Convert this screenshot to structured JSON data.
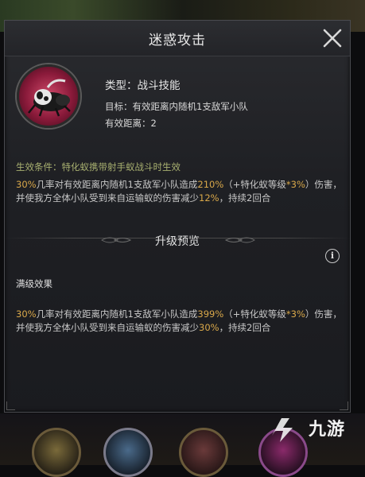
{
  "dialog": {
    "title": "迷惑攻击",
    "skill": {
      "type": "类型：战斗技能",
      "target": "目标：有效距离内随机1支敌军小队",
      "range": "有效距离：2",
      "icon": "ant-skill-icon"
    },
    "condition": "生效条件：特化蚁携带射手蚁战斗时生效",
    "effect": {
      "p1": "30%",
      "t1": "几率对有效距离内随机1支敌军小队造成",
      "p2": "210%",
      "t2": "（+特化蚁等级",
      "p3": "*3%",
      "t3": "）伤害，并使我方全体小队受到来自运输蚁的伤害减少",
      "p4": "12%",
      "t4": "，持续2回合"
    },
    "upgrade_title": "升级预览",
    "max_label": "满级效果",
    "max_effect": {
      "p1": "30%",
      "t1": "几率对有效距离内随机1支敌军小队造成",
      "p2": "399%",
      "t2": "（+特化蚁等级",
      "p3": "*3%",
      "t3": "）伤害，并使我方全体小队受到来自运输蚁的伤害减少",
      "p4": "30%",
      "t4": "，持续2回合"
    },
    "info_glyph": "i"
  },
  "watermark": {
    "text": "九游"
  },
  "colors": {
    "highlight": "#d9a84a",
    "condition": "#a8b070",
    "icon_bg": "#b02a4a"
  }
}
